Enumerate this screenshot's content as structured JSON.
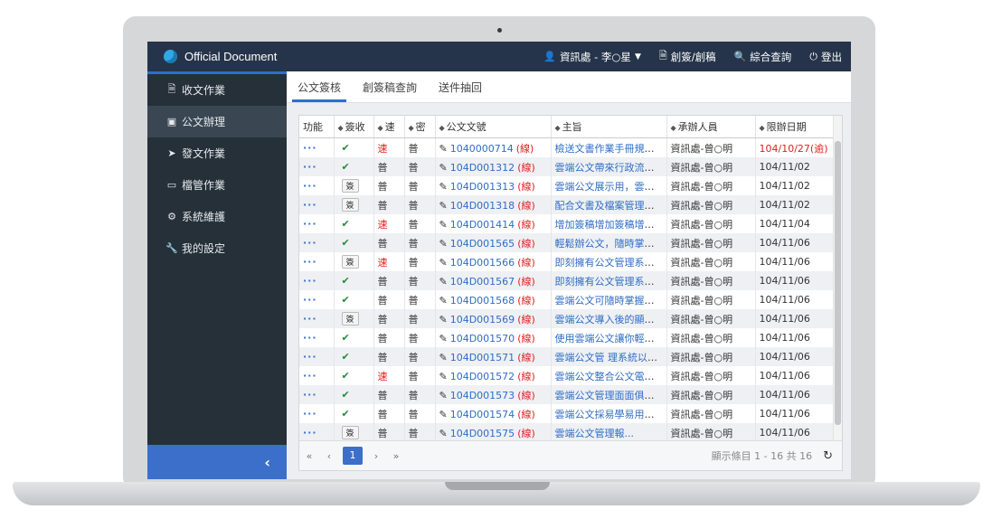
{
  "app": {
    "title": "Official Document"
  },
  "topnav": {
    "user": "資訊處 - 李○星",
    "sign_create": "創簽/創稿",
    "search": "綜合查詢",
    "logout": "登出"
  },
  "sidebar": {
    "items": [
      {
        "label": "收文作業",
        "icon": "inbox-icon"
      },
      {
        "label": "公文辦理",
        "icon": "briefcase-icon"
      },
      {
        "label": "發文作業",
        "icon": "send-icon"
      },
      {
        "label": "檔管作業",
        "icon": "folder-icon"
      },
      {
        "label": "系統維護",
        "icon": "gear-icon"
      },
      {
        "label": "我的設定",
        "icon": "wrench-icon"
      }
    ],
    "active_index": 1
  },
  "tabs": [
    "公文簽核",
    "創簽稿查詢",
    "送件抽回"
  ],
  "table": {
    "columns": [
      "功能",
      "簽收",
      "速",
      "密",
      "公文文號",
      "主旨",
      "承辦人員",
      "限辦日期"
    ],
    "rows": [
      {
        "sign": "check",
        "speed": "速",
        "secret": "普",
        "doc": "1040000714",
        "doc_tag": "(線)",
        "subject": "檢送文書作業手冊規範...",
        "handler": "資訊處-曾○明",
        "deadline": "104/10/27(逾)",
        "overdue": true
      },
      {
        "sign": "check",
        "speed": "普",
        "secret": "普",
        "doc": "104D001312",
        "doc_tag": "(線)",
        "subject": "雲端公文帶來行政流程...",
        "handler": "資訊處-曾○明",
        "deadline": "104/11/02",
        "overdue": false
      },
      {
        "sign": "button",
        "speed": "普",
        "secret": "普",
        "doc": "104D001313",
        "doc_tag": "(線)",
        "subject": "雲端公文展示用，雲端...",
        "handler": "資訊處-曾○明",
        "deadline": "104/11/02",
        "overdue": false
      },
      {
        "sign": "button",
        "speed": "普",
        "secret": "普",
        "doc": "104D001318",
        "doc_tag": "(線)",
        "subject": "配合文書及檔案管理電...",
        "handler": "資訊處-曾○明",
        "deadline": "104/11/02",
        "overdue": false
      },
      {
        "sign": "check",
        "speed": "速",
        "secret": "普",
        "doc": "104D001414",
        "doc_tag": "(線)",
        "subject": "增加簽稿增加簽稿增加...",
        "handler": "資訊處-曾○明",
        "deadline": "104/11/04",
        "overdue": false
      },
      {
        "sign": "check",
        "speed": "普",
        "secret": "普",
        "doc": "104D001565",
        "doc_tag": "(線)",
        "subject": "輕鬆辦公文，隨時掌握...",
        "handler": "資訊處-曾○明",
        "deadline": "104/11/06",
        "overdue": false
      },
      {
        "sign": "button",
        "speed": "速",
        "secret": "普",
        "doc": "104D001566",
        "doc_tag": "(線)",
        "subject": "即刻擁有公文管理系統...",
        "handler": "資訊處-曾○明",
        "deadline": "104/11/06",
        "overdue": false
      },
      {
        "sign": "check",
        "speed": "普",
        "secret": "普",
        "doc": "104D001567",
        "doc_tag": "(線)",
        "subject": "即刻擁有公文管理系統...",
        "handler": "資訊處-曾○明",
        "deadline": "104/11/06",
        "overdue": false
      },
      {
        "sign": "check",
        "speed": "普",
        "secret": "普",
        "doc": "104D001568",
        "doc_tag": "(線)",
        "subject": "雲端公文可隨時掌握公...",
        "handler": "資訊處-曾○明",
        "deadline": "104/11/06",
        "overdue": false
      },
      {
        "sign": "button",
        "speed": "普",
        "secret": "普",
        "doc": "104D001569",
        "doc_tag": "(線)",
        "subject": "雲端公文導入後的顯著...",
        "handler": "資訊處-曾○明",
        "deadline": "104/11/06",
        "overdue": false
      },
      {
        "sign": "check",
        "speed": "普",
        "secret": "普",
        "doc": "104D001570",
        "doc_tag": "(線)",
        "subject": "使用雲端公文讓你輕鬆...",
        "handler": "資訊處-曾○明",
        "deadline": "104/11/06",
        "overdue": false
      },
      {
        "sign": "check",
        "speed": "普",
        "secret": "普",
        "doc": "104D001571",
        "doc_tag": "(線)",
        "subject": "雲端公文管 理系統以「...",
        "handler": "資訊處-曾○明",
        "deadline": "104/11/06",
        "overdue": false
      },
      {
        "sign": "check",
        "speed": "速",
        "secret": "普",
        "doc": "104D001572",
        "doc_tag": "(線)",
        "subject": "雲端公文整合公文電子...",
        "handler": "資訊處-曾○明",
        "deadline": "104/11/06",
        "overdue": false
      },
      {
        "sign": "check",
        "speed": "普",
        "secret": "普",
        "doc": "104D001573",
        "doc_tag": "(線)",
        "subject": "雲端公文管理面面俱，...",
        "handler": "資訊處-曾○明",
        "deadline": "104/11/06",
        "overdue": false
      },
      {
        "sign": "check",
        "speed": "普",
        "secret": "普",
        "doc": "104D001574",
        "doc_tag": "(線)",
        "subject": "雲端公文採易學易用的...",
        "handler": "資訊處-曾○明",
        "deadline": "104/11/06",
        "overdue": false
      },
      {
        "sign": "button",
        "speed": "普",
        "secret": "普",
        "doc": "104D001575",
        "doc_tag": "(線)",
        "subject": "雲端公文管理報...",
        "handler": "資訊處-曾○明",
        "deadline": "104/11/06",
        "overdue": false
      }
    ],
    "func_label": "···",
    "sign_button_label": "簽"
  },
  "pager": {
    "first": "«",
    "prev": "‹",
    "current": "1",
    "next": "›",
    "last": "»",
    "info": "顯示條目 1 - 16 共 16"
  },
  "colors": {
    "topbar": "#25344a",
    "sidebar": "#253039",
    "accent": "#2e6fd0",
    "link": "#2f6dc5",
    "urgent": "#e02020"
  }
}
